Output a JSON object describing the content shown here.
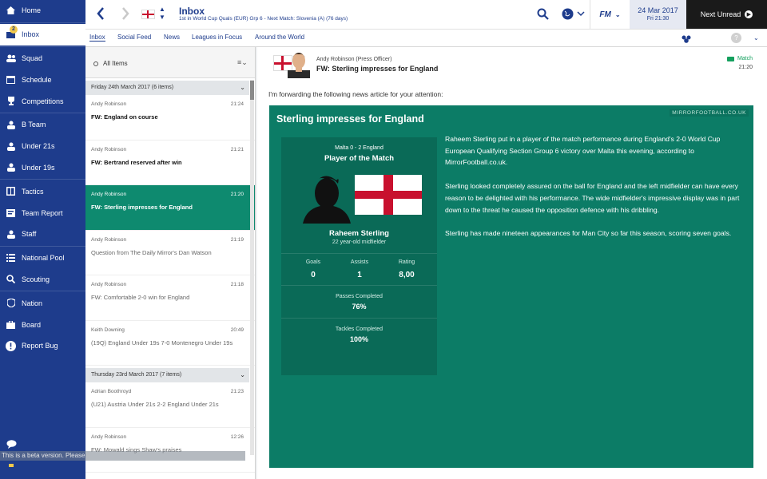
{
  "sidebar": {
    "items": [
      {
        "label": "Home",
        "icon": "home-icon"
      },
      {
        "label": "Inbox",
        "icon": "inbox-icon",
        "badge": "2",
        "active": true
      },
      {
        "label": "Squad",
        "icon": "squad-icon"
      },
      {
        "label": "Schedule",
        "icon": "calendar-icon"
      },
      {
        "label": "Competitions",
        "icon": "trophy-icon"
      },
      {
        "label": "B Team",
        "icon": "team-icon"
      },
      {
        "label": "Under 21s",
        "icon": "team-icon"
      },
      {
        "label": "Under 19s",
        "icon": "team-icon"
      },
      {
        "label": "Tactics",
        "icon": "tactics-icon"
      },
      {
        "label": "Team Report",
        "icon": "report-icon"
      },
      {
        "label": "Staff",
        "icon": "staff-icon"
      },
      {
        "label": "National Pool",
        "icon": "list-icon"
      },
      {
        "label": "Scouting",
        "icon": "search-icon"
      },
      {
        "label": "Nation",
        "icon": "shield-icon"
      },
      {
        "label": "Board",
        "icon": "briefcase-icon"
      },
      {
        "label": "Report Bug",
        "icon": "alert-icon"
      }
    ],
    "beta_notice": "This is a beta version. Please"
  },
  "header": {
    "title": "Inbox",
    "subtitle": "1st in World Cup Quals (EUR) Grp 6 - Next Match: Slovenia (A) (76 days)",
    "date": "24 Mar 2017",
    "time": "Fri 21:30",
    "next_unread": "Next Unread",
    "fm_logo": "FM"
  },
  "tabs": [
    "Inbox",
    "Social Feed",
    "News",
    "Leagues in Focus",
    "Around the World"
  ],
  "list": {
    "filter": "All Items",
    "groups": [
      {
        "header": "Friday 24th March 2017 (6 items)",
        "messages": [
          {
            "sender": "Andy Robinson",
            "time": "21:24",
            "subject": "FW: England on course",
            "state": "unread"
          },
          {
            "sender": "Andy Robinson",
            "time": "21:21",
            "subject": "FW: Bertrand reserved after win",
            "state": "unread"
          },
          {
            "sender": "Andy Robinson",
            "time": "21:20",
            "subject": "FW: Sterling impresses for England",
            "state": "selected"
          },
          {
            "sender": "Andy Robinson",
            "time": "21:19",
            "subject": "Question from The Daily Mirror's Dan Watson",
            "state": "read"
          },
          {
            "sender": "Andy Robinson",
            "time": "21:18",
            "subject": "FW: Comfortable 2-0 win for England",
            "state": "read"
          },
          {
            "sender": "Keith Downing",
            "time": "20:49",
            "subject": "(19Q) England Under 19s 7-0 Montenegro Under 19s",
            "state": "read"
          }
        ]
      },
      {
        "header": "Thursday 23rd March 2017 (7 items)",
        "messages": [
          {
            "sender": "Adrian Boothroyd",
            "time": "21:23",
            "subject": "(U21) Austria Under 21s 2-2 England Under 21s",
            "state": "read"
          },
          {
            "sender": "Andy Robinson",
            "time": "12:26",
            "subject": "FW: Mowald sings Shaw's praises",
            "state": "read"
          }
        ]
      }
    ]
  },
  "message": {
    "from": "Andy Robinson (Press Officer)",
    "subject": "FW: Sterling impresses for England",
    "tag": "Match",
    "time": "21:20",
    "intro": "I'm forwarding the following news article for your attention:",
    "article": {
      "source": "MIRRORFOOTBALL.CO.UK",
      "title": "Sterling impresses for England",
      "paragraphs": [
        "Raheem Sterling put in a player of the match performance during England's 2-0 World Cup European Qualifying Section Group 6 victory over Malta this evening, according to MirrorFootball.co.uk.",
        "Sterling looked completely assured on the ball for England and the left midfielder can have every reason to be delighted with his performance. The wide midfielder's impressive display was in part down to the threat he caused the opposition defence with his dribbling.",
        "Sterling has made nineteen appearances for Man City so far this season, scoring seven goals."
      ],
      "potm": {
        "result": "Malta 0 - 2 England",
        "heading": "Player of the Match",
        "name": "Raheem Sterling",
        "desc": "22 year-old midfielder",
        "stats": [
          {
            "label": "Goals",
            "value": "0"
          },
          {
            "label": "Assists",
            "value": "1"
          },
          {
            "label": "Rating",
            "value": "8,00"
          }
        ],
        "passes_label": "Passes Completed",
        "passes_value": "76%",
        "tackles_label": "Tackles Completed",
        "tackles_value": "100%"
      }
    }
  },
  "colors": {
    "sidebar": "#1e3c8c",
    "article": "#0c7c66",
    "selected": "#0e8a6f"
  }
}
